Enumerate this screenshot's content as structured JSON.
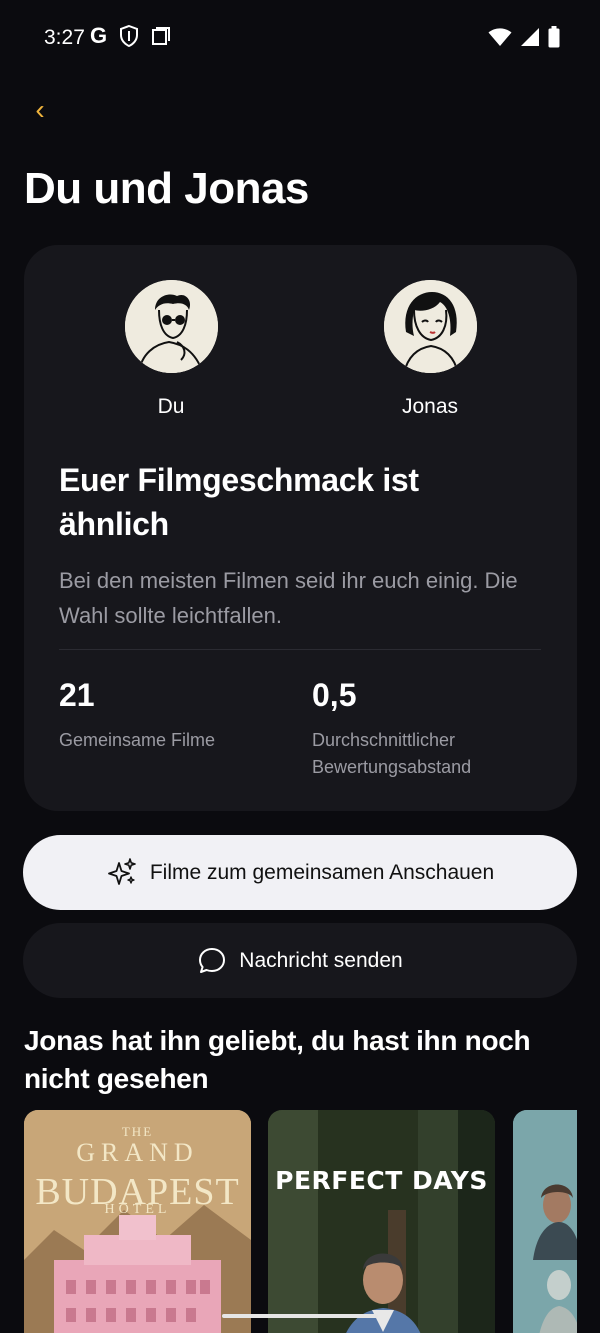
{
  "status_bar": {
    "time": "3:27",
    "left_icons": [
      "google-g-icon",
      "shield-icon",
      "screenshot-icon"
    ],
    "right_icons": [
      "wifi-icon",
      "signal-icon",
      "battery-icon"
    ]
  },
  "header": {
    "back_icon": "chevron-left-icon",
    "back_glyph": "‹",
    "title": "Du und Jonas"
  },
  "card": {
    "user_you": {
      "name": "Du"
    },
    "user_other": {
      "name": "Jonas"
    },
    "headline": "Euer Filmgeschmack ist ähnlich",
    "description": "Bei den meisten Filmen seid ihr euch einig. Die Wahl sollte leichtfallen.",
    "stats": [
      {
        "value": "21",
        "label": "Gemeinsame Filme"
      },
      {
        "value": "0,5",
        "label": "Durchschnittlicher Bewertungsabstand"
      }
    ]
  },
  "actions": {
    "watch_together": {
      "label": "Filme zum gemeinsamen Anschauen",
      "icon": "sparkles-icon"
    },
    "send_message": {
      "label": "Nachricht senden",
      "icon": "chat-bubble-icon"
    }
  },
  "section": {
    "title": "Jonas hat ihn geliebt, du hast ihn noch nicht gesehen",
    "posters": [
      {
        "title_lines": [
          "THE",
          "GRAND",
          "BUDAPEST",
          "HOTEL"
        ]
      },
      {
        "title": "PERFECT DAYS"
      },
      {
        "title": ""
      }
    ]
  },
  "colors": {
    "background": "#0b0b0f",
    "card": "#17171c",
    "accent": "#f0b43c",
    "muted_text": "#9b9ba3",
    "primary_button": "#f1f1f5"
  }
}
